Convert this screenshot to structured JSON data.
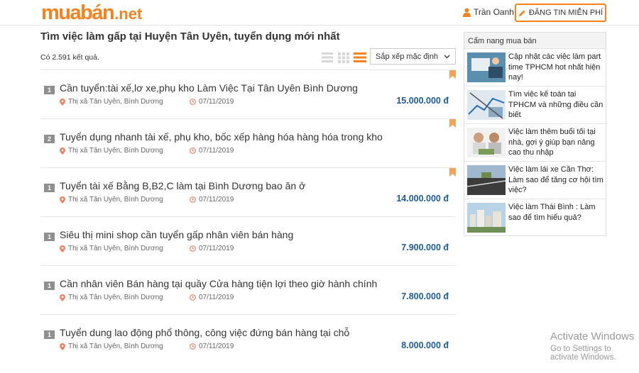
{
  "header": {
    "logo_main": "muabán",
    "logo_tld": ".net",
    "user_name": "Trần Oanh",
    "post_button": "ĐĂNG TIN MIỄN PHÍ"
  },
  "main": {
    "title": "Tìm việc làm gấp tại Huyện Tân Uyên, tuyển dụng mới nhất",
    "result_count": "Có 2.591 kết quả.",
    "sort_label": "Sắp xếp mặc định",
    "items": [
      {
        "badge": "1",
        "title": "Cần tuyển:tài xế,lơ xe,phụ kho Làm Việc Tại Tân Uyên Bình Dương",
        "location": "Thị xã Tân Uyên, Bình Dương",
        "date": "07/11/2019",
        "price": "15.000.000 đ"
      },
      {
        "badge": "2",
        "title": "Tuyển dụng nhanh tài xế, phụ kho, bốc xếp hàng hóa hàng hóa trong kho",
        "location": "Thị xã Tân Uyên, Bình Dương",
        "date": "07/11/2019",
        "price": ""
      },
      {
        "badge": "1",
        "title": "Tuyển tài xế Bằng B,B2,C làm tại Bình Dương bao ăn ở",
        "location": "Thị xã Tân Uyên, Bình Dương",
        "date": "07/11/2019",
        "price": "14.000.000 đ"
      },
      {
        "badge": "1",
        "title": "Siêu thị mini shop cần tuyển gấp nhân viên bán hàng",
        "location": "Thị xã Tân Uyên, Bình Dương",
        "date": "07/11/2019",
        "price": "7.900.000 đ"
      },
      {
        "badge": "1",
        "title": "Cần nhân viên Bán hàng tại quầy Cửa hàng tiện lợi theo giờ hành chính",
        "location": "Thị xã Tân Uyên, Bình Dương",
        "date": "07/11/2019",
        "price": "7.800.000 đ"
      },
      {
        "badge": "1",
        "title": "Tuyển dung lao động phổ thông, công việc đứng bán hàng tại chỗ",
        "location": "Thị xã Tân Uyên, Bình Dương",
        "date": "07/11/2019",
        "price": "8.000.000 đ"
      }
    ]
  },
  "sidebar": {
    "title": "Cẩm nang mua bán",
    "articles": [
      {
        "title": "Cập nhật các việc làm part time TPHCM hot nhất hiện nay!"
      },
      {
        "title": "Tìm việc kế toán tại TPHCM và những điều cần biết"
      },
      {
        "title": "Việc làm thêm buổi tối tại nhà, gợi ý giúp bạn nâng cao thu nhập"
      },
      {
        "title": "Việc làm lái xe Cần Thơ: Làm sao để tăng cơ hội tìm việc?"
      },
      {
        "title": "Việc làm Thái Bình : Làm sao để tìm hiểu quả?"
      }
    ]
  },
  "watermark": {
    "line1": "Activate Windows",
    "line2": "Go to Settings to activate Windows."
  },
  "colors": {
    "brand": "#f5821f",
    "price": "#1f5b95",
    "badge": "#8f8f8f"
  }
}
